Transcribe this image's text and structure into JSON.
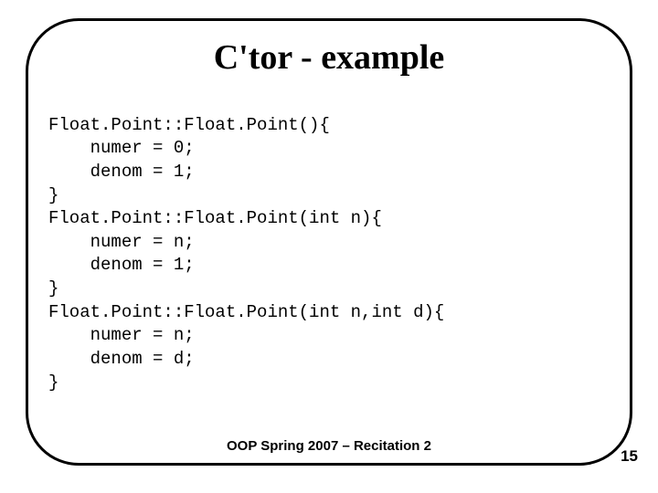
{
  "title": "C'tor - example",
  "code": {
    "lines": [
      "Float.Point::Float.Point(){",
      "    numer = 0;",
      "    denom = 1;",
      "}",
      "Float.Point::Float.Point(int n){",
      "    numer = n;",
      "    denom = 1;",
      "}",
      "Float.Point::Float.Point(int n,int d){",
      "    numer = n;",
      "    denom = d;",
      "}"
    ]
  },
  "footer": "OOP Spring 2007 – Recitation 2",
  "page_number": "15"
}
